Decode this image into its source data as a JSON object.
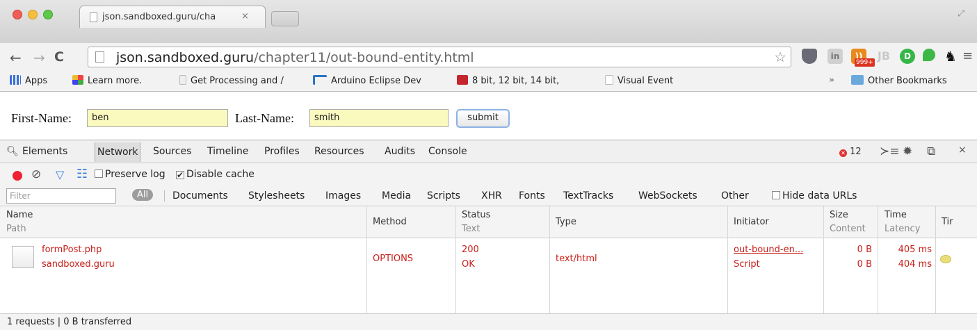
{
  "window": {
    "tab_title": "json.sandboxed.guru/cha",
    "tab_close": "×"
  },
  "toolbar": {
    "url_host": "json.sandboxed.guru",
    "url_path": "/chapter11/out-bound-entity.html",
    "rss_badge": "999+",
    "jb_label": "JB"
  },
  "bookmarks": {
    "items": [
      {
        "label": "Apps"
      },
      {
        "label": "Learn more."
      },
      {
        "label": "Get Processing and /"
      },
      {
        "label": "Arduino Eclipse Dev"
      },
      {
        "label": "8 bit, 12 bit, 14 bit,"
      },
      {
        "label": "Visual Event"
      }
    ],
    "more": "»",
    "other": "Other Bookmarks"
  },
  "form": {
    "first_label": "First-Name:",
    "first_value": "ben",
    "last_label": "Last-Name:",
    "last_value": "smith",
    "submit_label": "submit"
  },
  "devtools": {
    "tabs": [
      "Elements",
      "Network",
      "Sources",
      "Timeline",
      "Profiles",
      "Resources",
      "Audits",
      "Console"
    ],
    "active_tab": "Network",
    "error_count": "12",
    "preserve_log": "Preserve log",
    "disable_cache": "Disable cache",
    "filter_placeholder": "Filter",
    "filter_all": "All",
    "filters": [
      "Documents",
      "Stylesheets",
      "Images",
      "Media",
      "Scripts",
      "XHR",
      "Fonts",
      "TextTracks",
      "WebSockets",
      "Other"
    ],
    "hide_data_urls": "Hide data URLs",
    "columns": {
      "name": "Name",
      "path": "Path",
      "method": "Method",
      "status": "Status",
      "text": "Text",
      "type": "Type",
      "initiator": "Initiator",
      "size": "Size",
      "content": "Content",
      "time": "Time",
      "latency": "Latency",
      "timeline": "Tir"
    },
    "rows": [
      {
        "name": "formPost.php",
        "path": "sandboxed.guru",
        "method": "OPTIONS",
        "status": "200",
        "status_text": "OK",
        "type": "text/html",
        "initiator": "out-bound-en...",
        "initiator_type": "Script",
        "size": "0 B",
        "content": "0 B",
        "time": "405 ms",
        "latency": "404 ms"
      }
    ],
    "status": "1 requests | 0 B transferred"
  },
  "colors": {
    "error_text": "#c8201b",
    "input_bg": "#fafabf",
    "accent_blue": "#3b7ddd"
  }
}
